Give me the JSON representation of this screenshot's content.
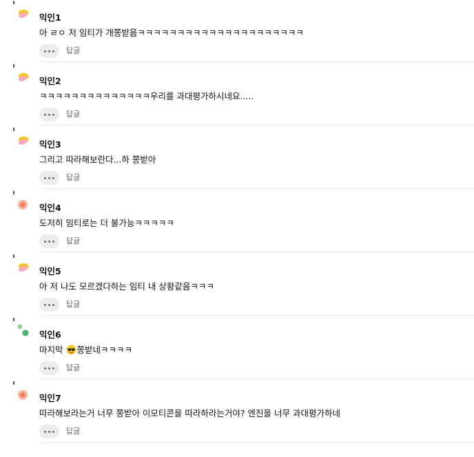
{
  "icons": {
    "avatar": "avatar-icon",
    "more": "more-options-icon",
    "emoji_sunglasses": "sunglasses-emoji-icon"
  },
  "comments": [
    {
      "nickname": "익인1",
      "text": "아 ㄹㅇ 저 임티가 개쫑받음ㅋㅋㅋㅋㅋㅋㅋㅋㅋㅋㅋㅋㅋㅋㅋㅋㅋㅋㅋㅋㅋ",
      "reply_label": "답글",
      "avatar_style": "cream"
    },
    {
      "nickname": "익인2",
      "text": "ㅋㅋㅋㅋㅋㅋㅋㅋㅋㅋㅋㅋㅋㅋ우리를 과대평가하시네요.....",
      "reply_label": "답글",
      "avatar_style": "cream"
    },
    {
      "nickname": "익인3",
      "text": "그리고 따라해보란다...하 쫑받아",
      "reply_label": "답글",
      "avatar_style": "cream"
    },
    {
      "nickname": "익인4",
      "text": "도저히 임티로는 더 불가능ㅋㅋㅋㅋㅋ",
      "reply_label": "답글",
      "avatar_style": "peach"
    },
    {
      "nickname": "익인5",
      "text": "아 저 나도 모르겠다하는 임티 내 상황같음ㅋㅋㅋ",
      "reply_label": "답글",
      "avatar_style": "cream"
    },
    {
      "nickname": "익인6",
      "text_before_emoji": "마지막",
      "text_after_emoji": "쫑받네ㅋㅋㅋㅋ",
      "reply_label": "답글",
      "avatar_style": "green"
    },
    {
      "nickname": "익인7",
      "text": "따라해보라는거 너무 쫑받아 이모티콘을 따라하라는거야? 엔진을 너무 과대평가하네",
      "reply_label": "답글",
      "avatar_style": "peach"
    }
  ],
  "colors": {
    "more_button_bg": "#ececec",
    "divider": "#e9e9e9",
    "cream_yellow": "#f7c325",
    "cream_pink": "#f4a7c0",
    "peach_outer": "#f6b49a",
    "peach_inner": "#f07b52",
    "green": "#43b86a"
  }
}
